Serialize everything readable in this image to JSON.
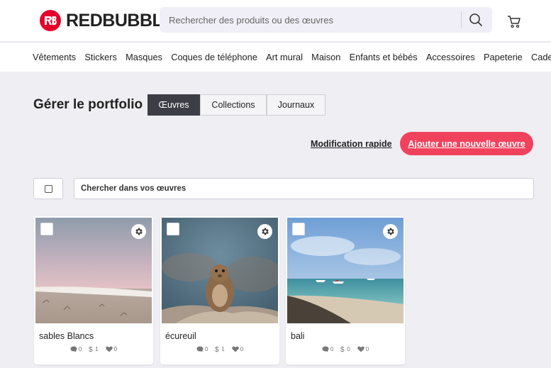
{
  "brand": {
    "name": "REDBUBBLE",
    "color": "#e4002b"
  },
  "search": {
    "placeholder": "Rechercher des produits ou des œuvres"
  },
  "nav": {
    "items": [
      "Vêtements",
      "Stickers",
      "Masques",
      "Coques de téléphone",
      "Art mural",
      "Maison",
      "Enfants et bébés",
      "Accessoires",
      "Papeterie",
      "Cadeaux"
    ]
  },
  "portfolio": {
    "title": "Gérer le portfolio",
    "tabs": [
      {
        "label": "Œuvres",
        "active": true
      },
      {
        "label": "Collections",
        "active": false
      },
      {
        "label": "Journaux",
        "active": false
      }
    ],
    "quick_edit_label": "Modification rapide",
    "add_button_label": "Ajouter une nouvelle œuvre",
    "accent": "#f0425c",
    "work_search_placeholder": "Chercher dans vos œuvres"
  },
  "works": [
    {
      "title": "sables Blancs",
      "comments": "0",
      "price": "1",
      "likes": "0"
    },
    {
      "title": "écureuil",
      "comments": "0",
      "price": "1",
      "likes": "0"
    },
    {
      "title": "bali",
      "comments": "0",
      "price": "0",
      "likes": "0"
    }
  ]
}
